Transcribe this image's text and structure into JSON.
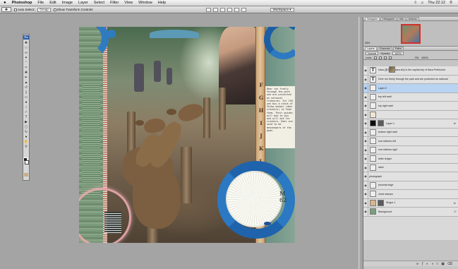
{
  "menubar": {
    "apple_icon": "apple-icon",
    "app_name": "Photoshop",
    "items": [
      "File",
      "Edit",
      "Image",
      "Layer",
      "Select",
      "Filter",
      "View",
      "Window",
      "Help"
    ],
    "clock": "Thu 22:12"
  },
  "options": {
    "auto_select_label": "Auto Select:",
    "auto_select_value": "Group",
    "show_transform_label": "Show Transform Controls",
    "workspace_label": "Workspace"
  },
  "toolbox": {
    "logo": "Ps",
    "foreground_color": "#1a1a1a",
    "background_color": "#ffffff"
  },
  "document": {
    "ruler_letters": [
      "F",
      "G",
      "H",
      "I",
      "J",
      "K",
      "L"
    ],
    "typecard_text": "Deer run freely through the park and are protected as national treasures. For 150 yen buy a stack of Shika-senbei (deer crackers) to feed them. Their guides will bow to you and will ask for crackers. Deer are said to be messengers of the gods.",
    "code_text": [
      "M",
      "62"
    ]
  },
  "panels": {
    "nav_tabs": [
      "Navigator",
      "Histogram",
      "Info",
      "Actions"
    ],
    "zoom": "25%",
    "layer_tabs": [
      "Layers",
      "Channels",
      "Paths"
    ],
    "blend_mode": "Normal",
    "opacity_label": "Opacity:",
    "opacity_value": "100%",
    "lock_label": "Lock:",
    "fill_label": "Fill:",
    "fill_value": "100%",
    "fx_label": "fx",
    "layers": [
      {
        "name": "Nara (奈良市, Nara-shi) is the capital city of Nara Prefecture",
        "thumb": "T",
        "selected": false
      },
      {
        "name": "Deer run freely through the park and are protected as national",
        "thumb": "T",
        "selected": false
      },
      {
        "name": "Layer 2",
        "thumb": "",
        "selected": true
      },
      {
        "name": "top left swirl",
        "thumb": "",
        "selected": false
      },
      {
        "name": "top right swirl",
        "thumb": "",
        "selected": false
      },
      {
        "name": "",
        "thumb": "",
        "selected": false
      },
      {
        "name": "Layer 1",
        "thumb": "",
        "selected": false
      },
      {
        "name": "bottom right swirl",
        "thumb": "",
        "selected": false
      },
      {
        "name": "rust stitches left",
        "thumb": "",
        "selected": false
      },
      {
        "name": "rust stitches right",
        "thumb": "",
        "selected": false
      },
      {
        "name": "letter ledger",
        "thumb": "",
        "selected": false
      },
      {
        "name": "label",
        "thumb": "",
        "selected": false
      },
      {
        "name": "photograph",
        "thumb": "",
        "selected": false
      },
      {
        "name": "pictorial edge",
        "thumb": "",
        "selected": false
      },
      {
        "name": "circle stamps",
        "thumb": "",
        "selected": false
      },
      {
        "name": "Shape 1",
        "thumb": "",
        "selected": false
      },
      {
        "name": "Background",
        "thumb": "",
        "selected": false
      }
    ]
  }
}
